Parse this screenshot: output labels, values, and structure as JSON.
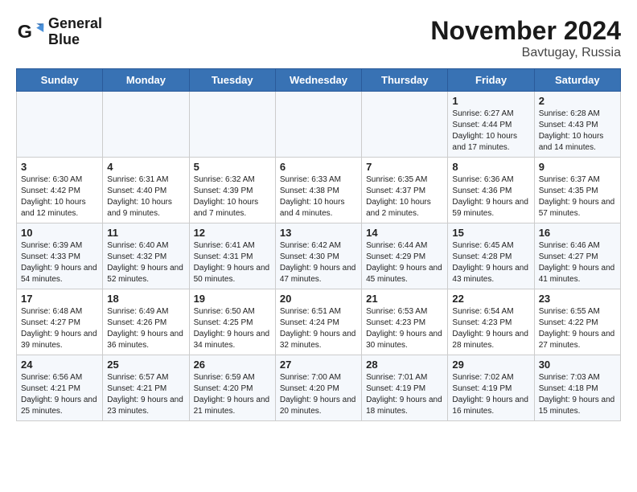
{
  "logo": {
    "line1": "General",
    "line2": "Blue"
  },
  "title": "November 2024",
  "location": "Bavtugay, Russia",
  "days_of_week": [
    "Sunday",
    "Monday",
    "Tuesday",
    "Wednesday",
    "Thursday",
    "Friday",
    "Saturday"
  ],
  "weeks": [
    [
      {
        "day": "",
        "info": ""
      },
      {
        "day": "",
        "info": ""
      },
      {
        "day": "",
        "info": ""
      },
      {
        "day": "",
        "info": ""
      },
      {
        "day": "",
        "info": ""
      },
      {
        "day": "1",
        "info": "Sunrise: 6:27 AM\nSunset: 4:44 PM\nDaylight: 10 hours and 17 minutes."
      },
      {
        "day": "2",
        "info": "Sunrise: 6:28 AM\nSunset: 4:43 PM\nDaylight: 10 hours and 14 minutes."
      }
    ],
    [
      {
        "day": "3",
        "info": "Sunrise: 6:30 AM\nSunset: 4:42 PM\nDaylight: 10 hours and 12 minutes."
      },
      {
        "day": "4",
        "info": "Sunrise: 6:31 AM\nSunset: 4:40 PM\nDaylight: 10 hours and 9 minutes."
      },
      {
        "day": "5",
        "info": "Sunrise: 6:32 AM\nSunset: 4:39 PM\nDaylight: 10 hours and 7 minutes."
      },
      {
        "day": "6",
        "info": "Sunrise: 6:33 AM\nSunset: 4:38 PM\nDaylight: 10 hours and 4 minutes."
      },
      {
        "day": "7",
        "info": "Sunrise: 6:35 AM\nSunset: 4:37 PM\nDaylight: 10 hours and 2 minutes."
      },
      {
        "day": "8",
        "info": "Sunrise: 6:36 AM\nSunset: 4:36 PM\nDaylight: 9 hours and 59 minutes."
      },
      {
        "day": "9",
        "info": "Sunrise: 6:37 AM\nSunset: 4:35 PM\nDaylight: 9 hours and 57 minutes."
      }
    ],
    [
      {
        "day": "10",
        "info": "Sunrise: 6:39 AM\nSunset: 4:33 PM\nDaylight: 9 hours and 54 minutes."
      },
      {
        "day": "11",
        "info": "Sunrise: 6:40 AM\nSunset: 4:32 PM\nDaylight: 9 hours and 52 minutes."
      },
      {
        "day": "12",
        "info": "Sunrise: 6:41 AM\nSunset: 4:31 PM\nDaylight: 9 hours and 50 minutes."
      },
      {
        "day": "13",
        "info": "Sunrise: 6:42 AM\nSunset: 4:30 PM\nDaylight: 9 hours and 47 minutes."
      },
      {
        "day": "14",
        "info": "Sunrise: 6:44 AM\nSunset: 4:29 PM\nDaylight: 9 hours and 45 minutes."
      },
      {
        "day": "15",
        "info": "Sunrise: 6:45 AM\nSunset: 4:28 PM\nDaylight: 9 hours and 43 minutes."
      },
      {
        "day": "16",
        "info": "Sunrise: 6:46 AM\nSunset: 4:27 PM\nDaylight: 9 hours and 41 minutes."
      }
    ],
    [
      {
        "day": "17",
        "info": "Sunrise: 6:48 AM\nSunset: 4:27 PM\nDaylight: 9 hours and 39 minutes."
      },
      {
        "day": "18",
        "info": "Sunrise: 6:49 AM\nSunset: 4:26 PM\nDaylight: 9 hours and 36 minutes."
      },
      {
        "day": "19",
        "info": "Sunrise: 6:50 AM\nSunset: 4:25 PM\nDaylight: 9 hours and 34 minutes."
      },
      {
        "day": "20",
        "info": "Sunrise: 6:51 AM\nSunset: 4:24 PM\nDaylight: 9 hours and 32 minutes."
      },
      {
        "day": "21",
        "info": "Sunrise: 6:53 AM\nSunset: 4:23 PM\nDaylight: 9 hours and 30 minutes."
      },
      {
        "day": "22",
        "info": "Sunrise: 6:54 AM\nSunset: 4:23 PM\nDaylight: 9 hours and 28 minutes."
      },
      {
        "day": "23",
        "info": "Sunrise: 6:55 AM\nSunset: 4:22 PM\nDaylight: 9 hours and 27 minutes."
      }
    ],
    [
      {
        "day": "24",
        "info": "Sunrise: 6:56 AM\nSunset: 4:21 PM\nDaylight: 9 hours and 25 minutes."
      },
      {
        "day": "25",
        "info": "Sunrise: 6:57 AM\nSunset: 4:21 PM\nDaylight: 9 hours and 23 minutes."
      },
      {
        "day": "26",
        "info": "Sunrise: 6:59 AM\nSunset: 4:20 PM\nDaylight: 9 hours and 21 minutes."
      },
      {
        "day": "27",
        "info": "Sunrise: 7:00 AM\nSunset: 4:20 PM\nDaylight: 9 hours and 20 minutes."
      },
      {
        "day": "28",
        "info": "Sunrise: 7:01 AM\nSunset: 4:19 PM\nDaylight: 9 hours and 18 minutes."
      },
      {
        "day": "29",
        "info": "Sunrise: 7:02 AM\nSunset: 4:19 PM\nDaylight: 9 hours and 16 minutes."
      },
      {
        "day": "30",
        "info": "Sunrise: 7:03 AM\nSunset: 4:18 PM\nDaylight: 9 hours and 15 minutes."
      }
    ]
  ]
}
